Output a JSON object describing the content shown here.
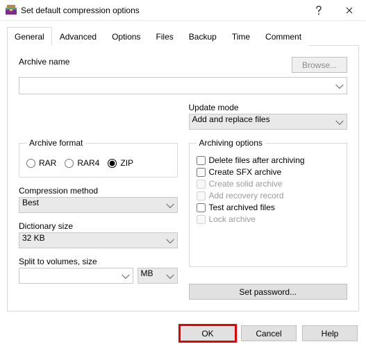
{
  "window": {
    "title": "Set default compression options"
  },
  "tabs": [
    "General",
    "Advanced",
    "Options",
    "Files",
    "Backup",
    "Time",
    "Comment"
  ],
  "general": {
    "archive_name_label": "Archive name",
    "archive_name_value": "",
    "browse_label": "Browse...",
    "update_mode_label": "Update mode",
    "update_mode_value": "Add and replace files",
    "archive_format_label": "Archive format",
    "formats": {
      "rar": "RAR",
      "rar4": "RAR4",
      "zip": "ZIP"
    },
    "format_selected": "zip",
    "compression_method_label": "Compression method",
    "compression_method_value": "Best",
    "dictionary_size_label": "Dictionary size",
    "dictionary_size_value": "32 KB",
    "split_label": "Split to volumes, size",
    "split_value": "",
    "split_unit": "MB",
    "archiving_options_label": "Archiving options",
    "opts": {
      "delete_after": "Delete files after archiving",
      "create_sfx": "Create SFX archive",
      "solid": "Create solid archive",
      "recovery": "Add recovery record",
      "test": "Test archived files",
      "lock": "Lock archive"
    },
    "set_password_label": "Set password..."
  },
  "footer": {
    "ok": "OK",
    "cancel": "Cancel",
    "help": "Help"
  }
}
